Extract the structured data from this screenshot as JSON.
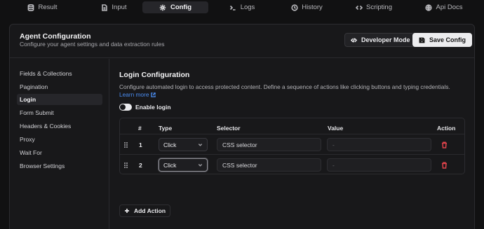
{
  "tabs": [
    {
      "label": "Result",
      "icon": "database-icon",
      "active": false
    },
    {
      "label": "Input",
      "icon": "document-icon",
      "active": false
    },
    {
      "label": "Config",
      "icon": "gear-icon",
      "active": true
    },
    {
      "label": "Logs",
      "icon": "terminal-icon",
      "active": false
    },
    {
      "label": "History",
      "icon": "history-icon",
      "active": false
    },
    {
      "label": "Scripting",
      "icon": "code-icon",
      "active": false
    },
    {
      "label": "Api Docs",
      "icon": "globe-icon",
      "active": false
    }
  ],
  "header": {
    "title": "Agent Configuration",
    "subtitle": "Configure your agent settings and data extraction rules",
    "developer_mode_label": "Developer Mode",
    "save_label": "Save Config"
  },
  "sidebar": {
    "items": [
      {
        "label": "Fields & Collections",
        "active": false
      },
      {
        "label": "Pagination",
        "active": false
      },
      {
        "label": "Login",
        "active": true
      },
      {
        "label": "Form Submit",
        "active": false
      },
      {
        "label": "Headers & Cookies",
        "active": false
      },
      {
        "label": "Proxy",
        "active": false
      },
      {
        "label": "Wait For",
        "active": false
      },
      {
        "label": "Browser Settings",
        "active": false
      }
    ]
  },
  "login": {
    "title": "Login Configuration",
    "description": "Configure automated login to access protected content. Define a sequence of actions like clicking buttons and typing credentials.",
    "learn_more": "Learn more",
    "enable_label": "Enable login",
    "enabled": true,
    "columns": [
      "#",
      "Type",
      "Selector",
      "Value",
      "Action"
    ],
    "rows": [
      {
        "num": "1",
        "type": "Click",
        "selector_placeholder": "CSS selector",
        "value_placeholder": "-"
      },
      {
        "num": "2",
        "type": "Click",
        "selector_placeholder": "CSS selector",
        "value_placeholder": "-"
      }
    ],
    "add_action_label": "Add Action"
  },
  "colors": {
    "background": "#111112",
    "card": "#18181a",
    "accent_link": "#4a8cf0",
    "danger": "#e0434b"
  }
}
